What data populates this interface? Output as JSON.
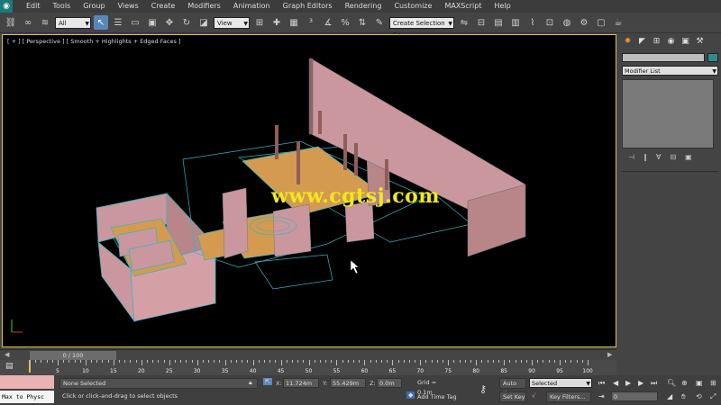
{
  "menu": {
    "items": [
      "Edit",
      "Tools",
      "Group",
      "Views",
      "Create",
      "Modifiers",
      "Animation",
      "Graph Editors",
      "Rendering",
      "Customize",
      "MAXScript",
      "Help"
    ]
  },
  "toolbar": {
    "filter_value": "All",
    "coord_value": "View",
    "selection_set_value": "Create Selection Se"
  },
  "viewport": {
    "label": "[ + ] [ Perspective ] [ Smooth + Highlights + Edged Faces ]",
    "watermark": "www.cgtsj.com"
  },
  "command_panel": {
    "modifier_list_label": "Modifier List"
  },
  "timeline": {
    "slider_label": "0 / 100",
    "ruler_labels": [
      "5",
      "10",
      "15",
      "20",
      "25",
      "30",
      "35",
      "40",
      "45",
      "50",
      "55",
      "60",
      "65",
      "70",
      "75",
      "80",
      "85",
      "90",
      "95",
      "100"
    ]
  },
  "status": {
    "script_output": "Max to Physc",
    "selection_status": "None Selected",
    "prompt": "Click or click-and-drag to select objects",
    "x_label": "X:",
    "x_value": "11.724m",
    "y_label": "Y:",
    "y_value": "55.429m",
    "z_label": "Z:",
    "z_value": "0.0m",
    "grid": "Grid = 0.1m",
    "add_time_tag": "Add Time Tag",
    "auto_key": "Auto Key",
    "set_key": "Set Key",
    "key_mode_value": "Selected",
    "key_filters": "Key Filters...",
    "frame_value": "0"
  },
  "colors": {
    "walls": "#c9979d",
    "floor": "#d49a4f",
    "wireframe": "#2fb6c8",
    "viewport_border": "#e3c24e",
    "watermark": "#f2e81c"
  }
}
